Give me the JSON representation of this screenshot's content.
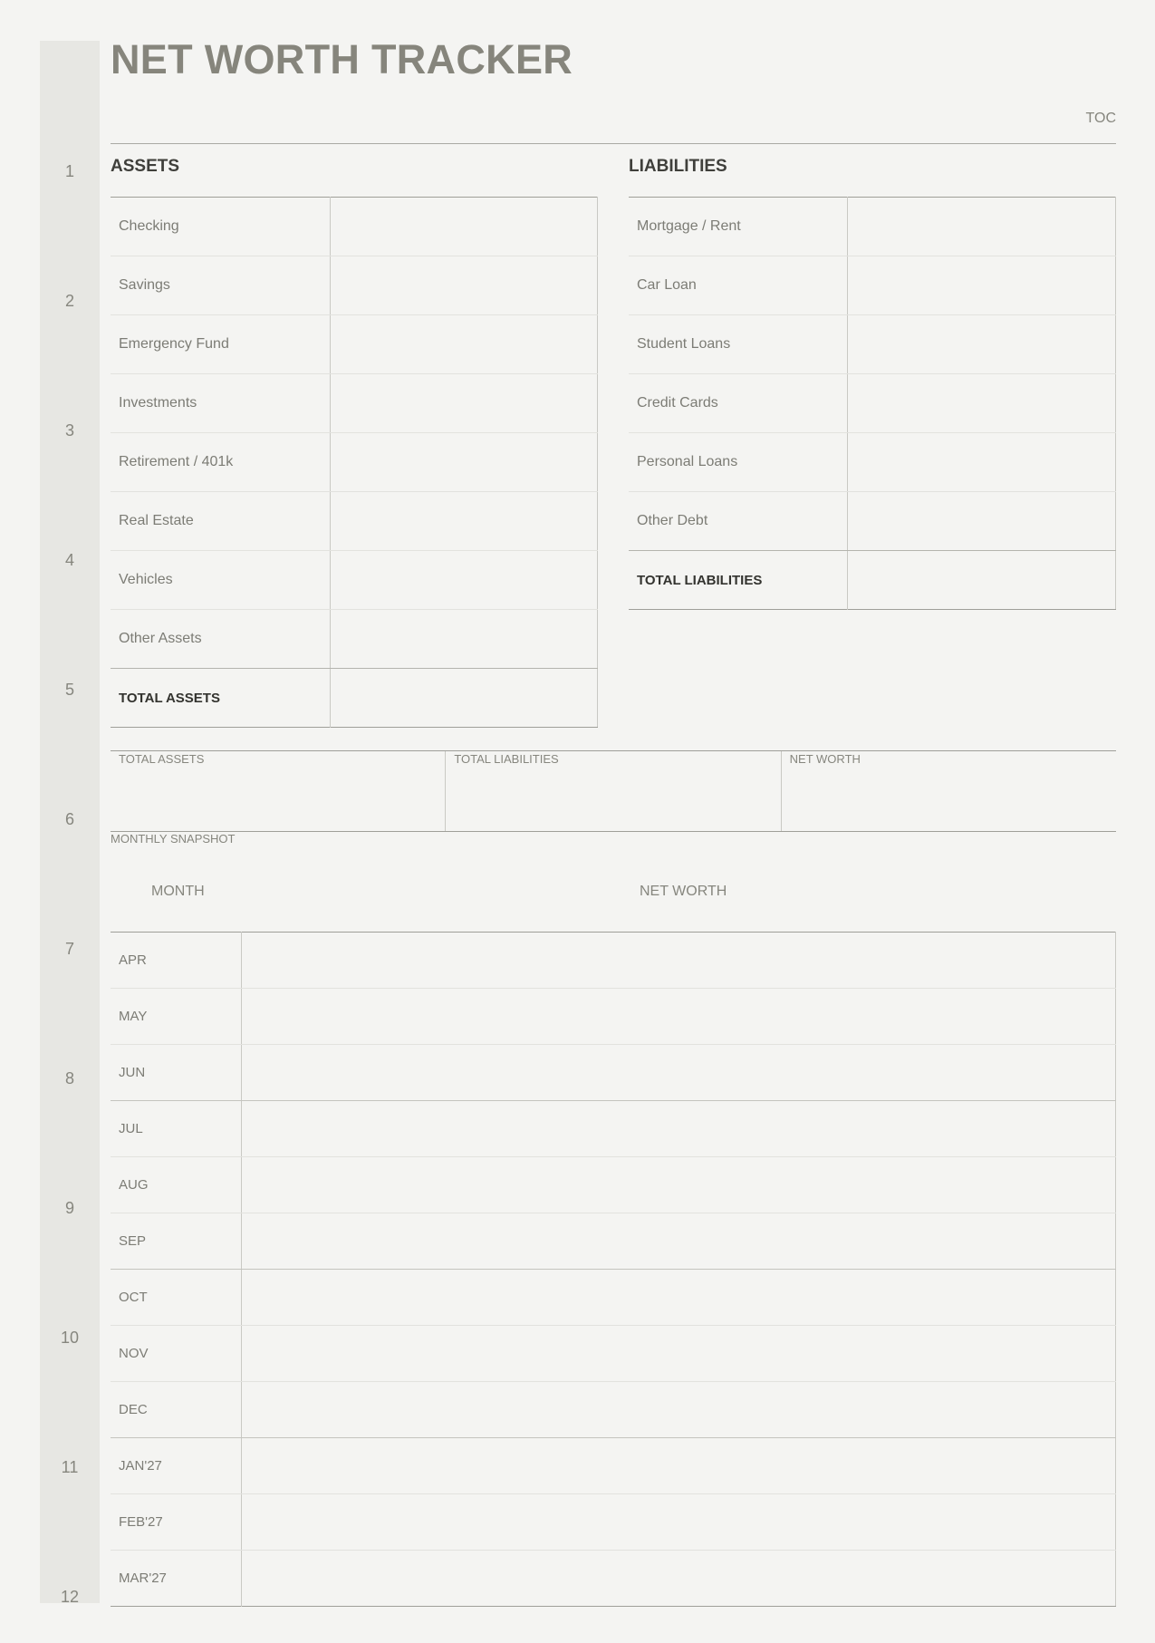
{
  "page": {
    "title": "NET WORTH TRACKER",
    "toc_label": "TOC"
  },
  "gutter_numbers": [
    "1",
    "2",
    "3",
    "4",
    "5",
    "6",
    "7",
    "8",
    "9",
    "10",
    "11",
    "12"
  ],
  "assets": {
    "heading": "ASSETS",
    "items": [
      "Checking",
      "Savings",
      "Emergency Fund",
      "Investments",
      "Retirement / 401k",
      "Real Estate",
      "Vehicles",
      "Other Assets"
    ],
    "total_label": "TOTAL ASSETS"
  },
  "liabilities": {
    "heading": "LIABILITIES",
    "items": [
      "Mortgage / Rent",
      "Car Loan",
      "Student Loans",
      "Credit Cards",
      "Personal Loans",
      "Other Debt"
    ],
    "total_label": "TOTAL LIABILITIES"
  },
  "summary": {
    "total_assets": "TOTAL ASSETS",
    "total_liabilities": "TOTAL LIABILITIES",
    "net_worth": "NET WORTH"
  },
  "snapshot": {
    "label": "MONTHLY SNAPSHOT",
    "col_month": "MONTH",
    "col_net_worth": "NET WORTH",
    "months": [
      "APR",
      "MAY",
      "JUN",
      "JUL",
      "AUG",
      "SEP",
      "OCT",
      "NOV",
      "DEC",
      "JAN'27",
      "FEB'27",
      "MAR'27"
    ]
  }
}
